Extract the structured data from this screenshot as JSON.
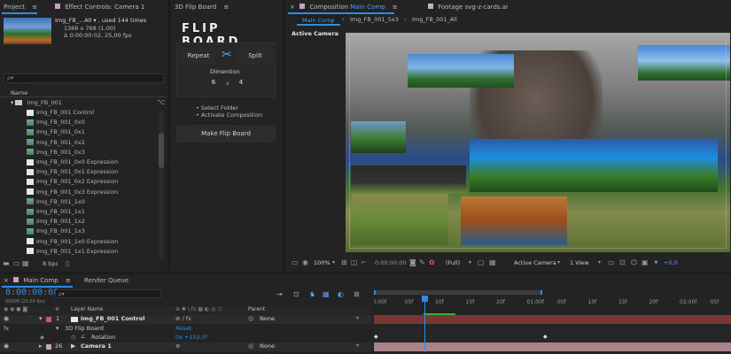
{
  "project_panel": {
    "tab_label": "Project",
    "menu_icon": "≡",
    "file_name": "Img_FB_...All",
    "used_text": "▾ , used 144 times",
    "dimensions": "1366 x 768 (1,00)",
    "duration": "Δ 0:00:00:02, 25,00 fps",
    "search_placeholder": "ρ▾",
    "column_name": "Name",
    "folder_name": "Img_FB_001",
    "items": [
      {
        "label": "Img_FB_001 Control",
        "type": "white"
      },
      {
        "label": "Img_FB_001_0x0",
        "type": "img"
      },
      {
        "label": "Img_FB_001_0x1",
        "type": "img"
      },
      {
        "label": "Img_FB_001_0x2",
        "type": "img"
      },
      {
        "label": "Img_FB_001_0x3",
        "type": "img"
      },
      {
        "label": "Img_FB_001_0x0 Expression",
        "type": "white"
      },
      {
        "label": "Img_FB_001_0x1 Expression",
        "type": "white"
      },
      {
        "label": "Img_FB_001_0x2 Expression",
        "type": "white"
      },
      {
        "label": "Img_FB_001_0x3 Expression",
        "type": "white"
      },
      {
        "label": "Img_FB_001_1x0",
        "type": "img"
      },
      {
        "label": "Img_FB_001_1x1",
        "type": "img"
      },
      {
        "label": "Img_FB_001_1x2",
        "type": "img"
      },
      {
        "label": "Img_FB_001_1x3",
        "type": "img"
      },
      {
        "label": "Img_FB_001_1x0 Expression",
        "type": "white"
      },
      {
        "label": "Img_FB_001_1x1 Expression",
        "type": "white"
      }
    ],
    "bpc_label": "8 bpc"
  },
  "effect_controls": {
    "tab_label": "Effect Controls: Camera 1"
  },
  "flipboard_panel": {
    "tab_label": "3D Flip Board",
    "logo": "FLIP BOARD",
    "repeat_label": "Repeat",
    "split_label": "Split",
    "dimention_label": "Dimention",
    "dim_x": "6",
    "dim_sep": "x",
    "dim_y": "4",
    "instructions": [
      "• Select Folder",
      "• Activate Composition"
    ],
    "make_label": "Make Flip Board"
  },
  "composition_panel": {
    "tab_label": "Composition",
    "tab_comp_name": "Main Comp",
    "footage_tab": "Footage svg-z-cards.ai",
    "subtabs": [
      "Main Comp",
      "Img_FB_001_5x3",
      "Img_FB_001_All"
    ],
    "view_label": "Active Camera",
    "zoom": "100%",
    "timecode": "0:00:00:00",
    "resolution": "(Full)",
    "camera_select": "Active Camera",
    "views_select": "1 View",
    "exposure": "+0,0"
  },
  "timeline": {
    "tab_label": "Main Comp",
    "render_queue": "Render Queue",
    "current_time": "0:00:00:08",
    "frame_info": "00008 (25.00 fps)",
    "search_placeholder": "ρ▾",
    "col_layer_name": "Layer Name",
    "col_parent": "Parent",
    "layers": [
      {
        "num": "1",
        "name": "Img_FB_001 Control",
        "parent": "None"
      },
      {
        "num": "26",
        "name": "Camera 1",
        "parent": "None"
      }
    ],
    "effect_name": "3D Flip Board",
    "reset_label": "Reset",
    "rotation_label": "Rotation",
    "rotation_value": "0x +102,0°",
    "ruler": [
      "):00f",
      "05f",
      "10f",
      "15f",
      "20f",
      "01:00f",
      "05f",
      "10f",
      "15f",
      "20f",
      "02:00f",
      "05f"
    ],
    "colors": {
      "accent": "#2d8ceb",
      "layer_bar": "#8a3a3a",
      "camera_bar": "#b58b92",
      "timecode": "#2d8ceb"
    }
  }
}
